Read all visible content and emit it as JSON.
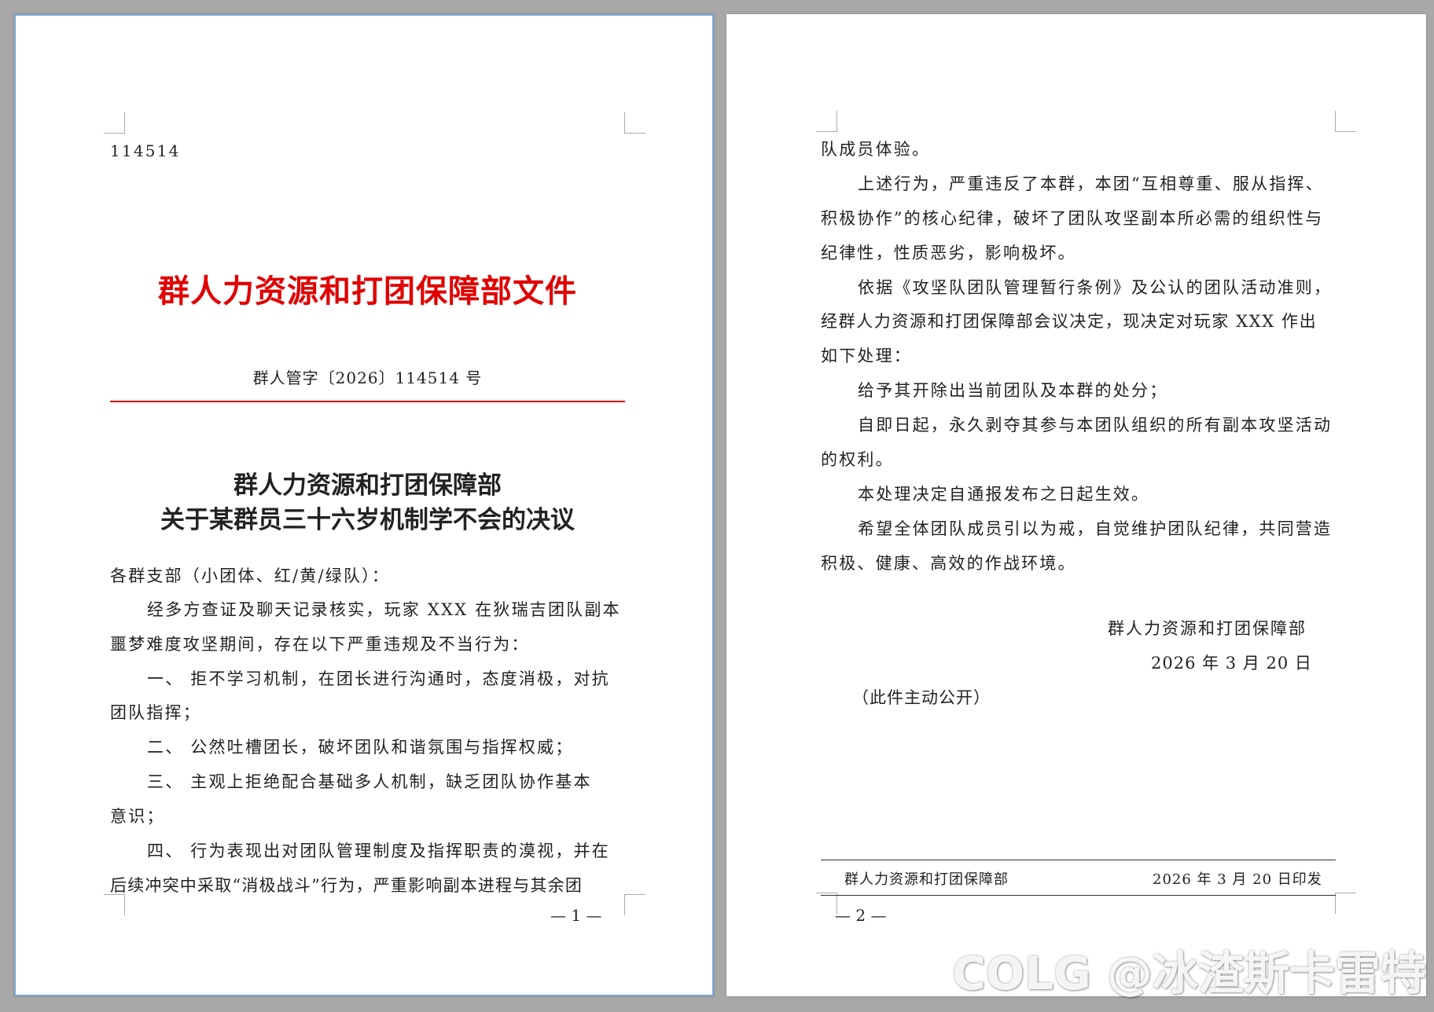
{
  "page1": {
    "serial": "114514",
    "header_title": "群人力资源和打团保障部文件",
    "doc_number": "群人管字〔2026〕114514 号",
    "title_line1": "群人力资源和打团保障部",
    "title_line2": "关于某群员三十六岁机制学不会的决议",
    "lines": [
      "各群支部（小团体、红/黄/绿队）：",
      "经多方查证及聊天记录核实，玩家 XXX 在狄瑞吉团队副本",
      "噩梦难度攻坚期间，存在以下严重违规及不当行为：",
      "一、  拒不学习机制，在团长进行沟通时，态度消极，对抗",
      "团队指挥；",
      "二、  公然吐槽团长，破坏团队和谐氛围与指挥权威；",
      "三、  主观上拒绝配合基础多人机制，缺乏团队协作基本",
      "意识；",
      "四、  行为表现出对团队管理制度及指挥职责的漠视，并在",
      "后续冲突中采取“消极战斗”行为，严重影响副本进程与其余团"
    ],
    "page_number": "— 1 —"
  },
  "page2": {
    "lines": [
      "队成员体验。",
      "上述行为，严重违反了本群，本团“互相尊重、服从指挥、",
      "积极协作”的核心纪律，破坏了团队攻坚副本所必需的组织性与",
      "纪律性，性质恶劣，影响极坏。",
      "依据《攻坚队团队管理暂行条例》及公认的团队活动准则，",
      "经群人力资源和打团保障部会议决定，现决定对玩家 XXX 作出",
      "如下处理：",
      "给予其开除出当前团队及本群的处分；",
      "自即日起，永久剥夺其参与本团队组织的所有副本攻坚活动",
      "的权利。",
      "本处理决定自通报发布之日起生效。",
      "希望全体团队成员引以为戒，自觉维护团队纪律，共同营造",
      "积极、健康、高效的作战环境。"
    ],
    "signature_org": "群人力资源和打团保障部",
    "signature_date": "2026 年 3 月 20 日",
    "public_note": "（此件主动公开）",
    "footer_org": "群人力资源和打团保障部",
    "footer_date": "2026 年 3 月 20 日印发",
    "page_number": "— 2 —"
  },
  "watermark": "COLG @冰渣斯卡雷特",
  "colors": {
    "accent_red": "#e00000",
    "selection_border": "#7ea6d8"
  }
}
